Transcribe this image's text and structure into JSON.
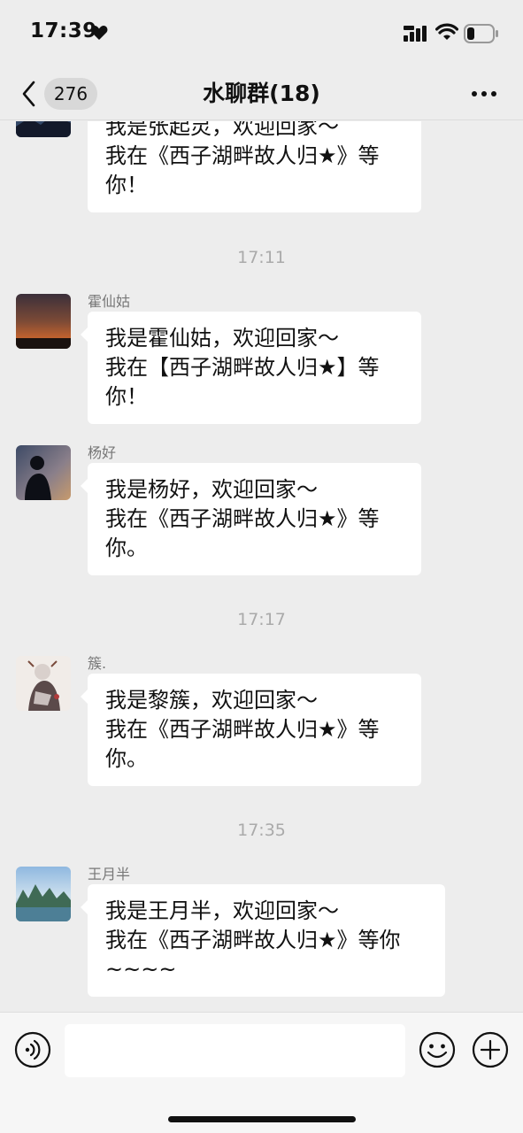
{
  "status_bar": {
    "time": "17:39",
    "icons": [
      "heart-icon",
      "cellular-signal-icon",
      "wifi-icon",
      "battery-icon"
    ]
  },
  "nav": {
    "unread_count": "276",
    "title": "水聊群(18)",
    "icons": [
      "back-icon",
      "more-icon"
    ]
  },
  "messages": [
    {
      "type": "message",
      "sender": "",
      "avatar": "night-landscape-avatar",
      "lines": [
        "我是张起灵，欢迎回家～",
        "我在《西子湖畔故人归★》等",
        "你！"
      ]
    },
    {
      "type": "timestamp",
      "text": "17:11"
    },
    {
      "type": "message",
      "sender": "霍仙姑",
      "avatar": "sunset-avatar",
      "lines": [
        "我是霍仙姑，欢迎回家～",
        "我在【西子湖畔故人归★】等",
        "你！"
      ]
    },
    {
      "type": "message",
      "sender": "杨好",
      "avatar": "silhouette-avatar",
      "lines": [
        "我是杨好，欢迎回家～",
        "我在《西子湖畔故人归★》等",
        "你。"
      ]
    },
    {
      "type": "timestamp",
      "text": "17:17"
    },
    {
      "type": "message",
      "sender": "簇.",
      "avatar": "anime-character-avatar",
      "lines": [
        "我是黎簇，欢迎回家～",
        "我在《西子湖畔故人归★》等",
        "你。"
      ]
    },
    {
      "type": "timestamp",
      "text": "17:35"
    },
    {
      "type": "message",
      "sender": "王月半",
      "avatar": "river-landscape-avatar",
      "lines": [
        "我是王月半，欢迎回家～",
        "我在《西子湖畔故人归★》等你",
        "~~~~"
      ]
    }
  ],
  "input_bar": {
    "placeholder": "",
    "icons": [
      "voice-icon",
      "emoji-icon",
      "plus-icon"
    ]
  }
}
